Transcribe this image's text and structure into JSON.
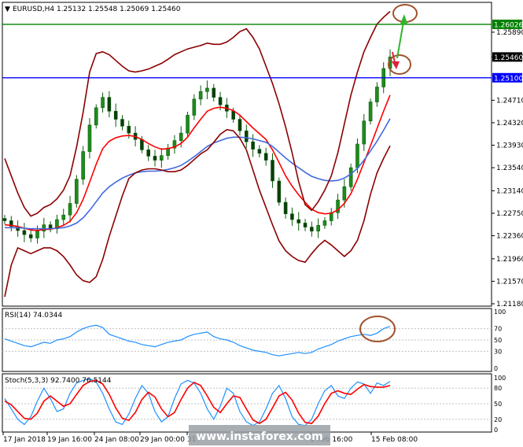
{
  "chart_data": {
    "type": "line",
    "symbol_info": "EURUSD,H4  1.25132 1.25548 1.25069 1.25460",
    "main": {
      "ylim": [
        1.2118,
        1.2638
      ],
      "y_ticks": [
        "1.25890",
        "1.25460",
        "1.24710",
        "1.24320",
        "1.23930",
        "1.23540",
        "1.23140",
        "1.22750",
        "1.22360",
        "1.21960",
        "1.21570",
        "1.21180"
      ],
      "y_tick_values": [
        1.2589,
        1.2546,
        1.2471,
        1.2432,
        1.2393,
        1.2354,
        1.2314,
        1.2275,
        1.2236,
        1.2196,
        1.2157,
        1.2118
      ],
      "price_labels": [
        {
          "text": "1.26026",
          "value": 1.26026,
          "color": "#008000"
        },
        {
          "text": "1.25460",
          "value": 1.2546,
          "color": "#000000"
        },
        {
          "text": "1.25100",
          "value": 1.251,
          "color": "#0000ff"
        }
      ],
      "hlines": [
        {
          "value": 1.26026,
          "color": "#008000"
        },
        {
          "value": 1.251,
          "color": "#0000ff"
        }
      ],
      "series": [
        {
          "key": "close",
          "color": "#006400",
          "values": [
            1.2262,
            1.2252,
            1.2245,
            1.2238,
            1.2232,
            1.2244,
            1.2255,
            1.2248,
            1.2264,
            1.2272,
            1.2292,
            1.2334,
            1.2382,
            1.2428,
            1.2458,
            1.2476,
            1.2452,
            1.2438,
            1.2426,
            1.2414,
            1.2403,
            1.2385,
            1.2374,
            1.2367,
            1.2375,
            1.2388,
            1.2401,
            1.2414,
            1.2445,
            1.2473,
            1.2486,
            1.2492,
            1.2476,
            1.2463,
            1.2452,
            1.2438,
            1.2418,
            1.2399,
            1.2386,
            1.2379,
            1.2367,
            1.2331,
            1.2294,
            1.2274,
            1.2264,
            1.2258,
            1.2251,
            1.2244,
            1.2254,
            1.2262,
            1.2276,
            1.2298,
            1.2321,
            1.2354,
            1.2395,
            1.2435,
            1.2468,
            1.2494,
            1.2526,
            1.2546
          ]
        },
        {
          "key": "ema_fast",
          "color": "#ff0000",
          "values": [
            1.2255,
            1.2254,
            1.2252,
            1.2249,
            1.2246,
            1.2245,
            1.2247,
            1.2247,
            1.225,
            1.2254,
            1.2261,
            1.2276,
            1.2299,
            1.2329,
            1.236,
            1.2387,
            1.24,
            1.2406,
            1.2409,
            1.241,
            1.2408,
            1.2403,
            1.2396,
            1.239,
            1.2386,
            1.2387,
            1.239,
            1.2396,
            1.2407,
            1.2423,
            1.2438,
            1.2452,
            1.2457,
            1.2459,
            1.2457,
            1.2453,
            1.2445,
            1.2434,
            1.2423,
            1.2413,
            1.2403,
            1.2385,
            1.2363,
            1.234,
            1.2322,
            1.2307,
            1.2294,
            1.2282,
            1.2276,
            1.2274,
            1.2275,
            1.2281,
            1.2292,
            1.2309,
            1.2334,
            1.2363,
            1.2392,
            1.2422,
            1.2452,
            1.248
          ]
        },
        {
          "key": "ema_slow",
          "color": "#4169e1",
          "values": [
            1.225,
            1.225,
            1.225,
            1.2249,
            1.2248,
            1.2248,
            1.2248,
            1.2248,
            1.2249,
            1.225,
            1.2253,
            1.2258,
            1.2267,
            1.228,
            1.2295,
            1.231,
            1.2321,
            1.2329,
            1.2336,
            1.2341,
            1.2345,
            1.2347,
            1.2348,
            1.2348,
            1.2349,
            1.2351,
            1.2354,
            1.2358,
            1.2365,
            1.2373,
            1.2382,
            1.2391,
            1.2397,
            1.2401,
            1.2405,
            1.2407,
            1.2407,
            1.2406,
            1.2404,
            1.2401,
            1.2398,
            1.2391,
            1.2381,
            1.2371,
            1.2362,
            1.2354,
            1.2346,
            1.2339,
            1.2335,
            1.2332,
            1.2331,
            1.2332,
            1.2336,
            1.2343,
            1.2353,
            1.2367,
            1.2383,
            1.24,
            1.2419,
            1.2439
          ]
        },
        {
          "key": "bb_upper",
          "color": "#8b0000",
          "values": [
            1.237,
            1.234,
            1.231,
            1.2285,
            1.227,
            1.2275,
            1.2285,
            1.229,
            1.23,
            1.2315,
            1.234,
            1.239,
            1.245,
            1.252,
            1.2552,
            1.2555,
            1.255,
            1.254,
            1.253,
            1.2522,
            1.252,
            1.2522,
            1.2525,
            1.253,
            1.2535,
            1.2542,
            1.255,
            1.2555,
            1.256,
            1.2563,
            1.2566,
            1.257,
            1.2568,
            1.2568,
            1.2572,
            1.258,
            1.259,
            1.2595,
            1.258,
            1.256,
            1.253,
            1.25,
            1.2465,
            1.2425,
            1.238,
            1.233,
            1.229,
            1.228,
            1.2295,
            1.2315,
            1.234,
            1.238,
            1.243,
            1.248,
            1.252,
            1.2555,
            1.258,
            1.2603,
            1.2615,
            1.2625
          ]
        },
        {
          "key": "bb_lower",
          "color": "#8b0000",
          "values": [
            1.213,
            1.2185,
            1.2215,
            1.221,
            1.2205,
            1.221,
            1.2215,
            1.2215,
            1.221,
            1.22,
            1.2185,
            1.2168,
            1.2158,
            1.2155,
            1.2165,
            1.2195,
            1.2235,
            1.227,
            1.2305,
            1.2335,
            1.2345,
            1.235,
            1.2352,
            1.2352,
            1.235,
            1.2347,
            1.2347,
            1.235,
            1.2358,
            1.2368,
            1.2378,
            1.2385,
            1.2398,
            1.2412,
            1.242,
            1.2418,
            1.2405,
            1.2385,
            1.235,
            1.2315,
            1.2285,
            1.2255,
            1.2227,
            1.221,
            1.22,
            1.2193,
            1.219,
            1.2205,
            1.2218,
            1.2228,
            1.222,
            1.221,
            1.22,
            1.221,
            1.2228,
            1.2262,
            1.2308,
            1.2345,
            1.237,
            1.2392
          ]
        }
      ]
    },
    "rsi": {
      "label": "RSI(14) 74.0344",
      "ylim": [
        0,
        100
      ],
      "levels": [
        70,
        50,
        30
      ],
      "y_ticks": [
        "100",
        "70",
        "50",
        "30",
        "0"
      ],
      "y_tick_values": [
        100,
        70,
        50,
        30,
        0
      ],
      "color": "#1e90ff",
      "values": [
        52,
        48,
        44,
        40,
        38,
        42,
        46,
        44,
        50,
        52,
        56,
        64,
        70,
        74,
        76,
        72,
        60,
        56,
        52,
        48,
        46,
        42,
        40,
        38,
        42,
        46,
        48,
        50,
        56,
        60,
        62,
        64,
        56,
        52,
        50,
        46,
        40,
        36,
        32,
        30,
        28,
        24,
        22,
        24,
        26,
        28,
        26,
        28,
        34,
        38,
        42,
        48,
        52,
        56,
        58,
        60,
        58,
        62,
        70,
        74
      ]
    },
    "stoch": {
      "label": "Stoch(5,3,3) 92.7400 76.5144",
      "ylim": [
        0,
        100
      ],
      "levels": [
        80,
        50,
        20
      ],
      "y_ticks": [
        "100",
        "80",
        "50",
        "20",
        "0"
      ],
      "y_tick_values": [
        100,
        80,
        50,
        20,
        0
      ],
      "series": [
        {
          "key": "main",
          "color": "#1e90ff",
          "values": [
            60,
            40,
            20,
            10,
            25,
            55,
            80,
            60,
            35,
            40,
            70,
            90,
            95,
            98,
            92,
            70,
            40,
            15,
            10,
            30,
            60,
            85,
            70,
            35,
            15,
            25,
            60,
            88,
            95,
            90,
            70,
            40,
            20,
            45,
            80,
            70,
            35,
            15,
            8,
            15,
            40,
            70,
            85,
            60,
            25,
            10,
            8,
            20,
            50,
            75,
            85,
            65,
            60,
            80,
            92,
            88,
            70,
            90,
            85,
            93
          ]
        },
        {
          "key": "signal",
          "color": "#ff0000",
          "values": [
            55,
            48,
            35,
            22,
            20,
            32,
            55,
            65,
            55,
            45,
            50,
            68,
            85,
            93,
            95,
            88,
            68,
            42,
            22,
            18,
            33,
            58,
            72,
            63,
            40,
            25,
            33,
            58,
            80,
            91,
            85,
            65,
            43,
            33,
            50,
            65,
            62,
            40,
            19,
            12,
            20,
            42,
            65,
            72,
            57,
            32,
            14,
            12,
            26,
            50,
            70,
            75,
            70,
            68,
            78,
            87,
            83,
            82,
            82,
            85
          ]
        }
      ]
    },
    "x_tick_labels": [
      "17 Jan 2018",
      "19 Jan 16:00",
      "24 Jan 08:00",
      "29 Jan 00:00",
      "31",
      "2 Feb 16:00",
      "15 Feb 08:00"
    ],
    "annotations": {
      "watermark": "www.instaforex.com"
    }
  }
}
